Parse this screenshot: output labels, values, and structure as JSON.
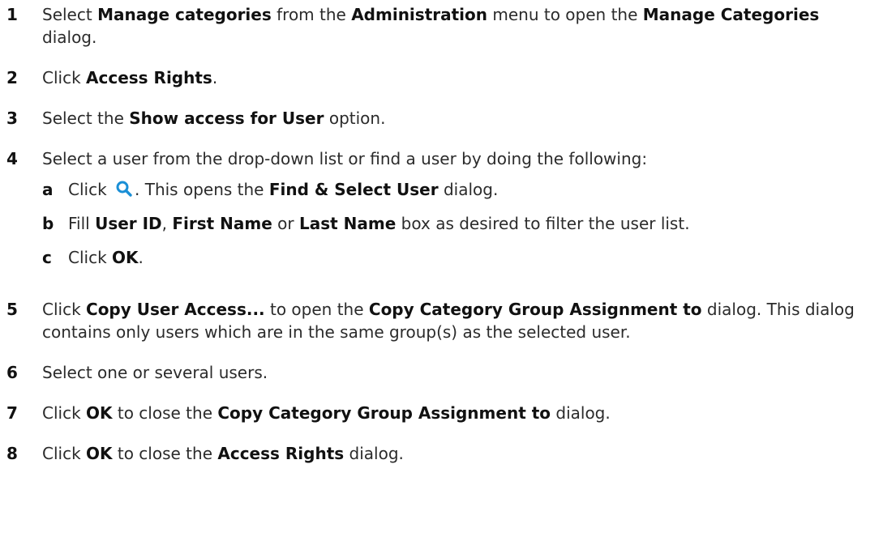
{
  "steps": [
    {
      "num": "1",
      "parts": [
        {
          "t": "Select "
        },
        {
          "t": "Manage categories",
          "b": true
        },
        {
          "t": " from the "
        },
        {
          "t": "Administration",
          "b": true
        },
        {
          "t": " menu to open the "
        },
        {
          "t": "Manage Categories",
          "b": true
        },
        {
          "t": " dialog."
        }
      ]
    },
    {
      "num": "2",
      "parts": [
        {
          "t": "Click "
        },
        {
          "t": "Access Rights",
          "b": true
        },
        {
          "t": "."
        }
      ]
    },
    {
      "num": "3",
      "parts": [
        {
          "t": "Select the "
        },
        {
          "t": "Show access for User",
          "b": true
        },
        {
          "t": " option."
        }
      ]
    },
    {
      "num": "4",
      "parts": [
        {
          "t": "Select a user from the drop-down list or find a user by doing the following:"
        }
      ],
      "sub": [
        {
          "num": "a",
          "parts": [
            {
              "t": "Click "
            },
            {
              "icon": "search-icon"
            },
            {
              "t": ". This opens the "
            },
            {
              "t": "Find & Select User",
              "b": true
            },
            {
              "t": " dialog."
            }
          ]
        },
        {
          "num": "b",
          "parts": [
            {
              "t": "Fill "
            },
            {
              "t": "User ID",
              "b": true
            },
            {
              "t": ", "
            },
            {
              "t": "First Name",
              "b": true
            },
            {
              "t": " or "
            },
            {
              "t": "Last Name",
              "b": true
            },
            {
              "t": " box as desired to filter the user list."
            }
          ]
        },
        {
          "num": "c",
          "parts": [
            {
              "t": "Click "
            },
            {
              "t": "OK",
              "b": true
            },
            {
              "t": "."
            }
          ]
        }
      ]
    },
    {
      "num": "5",
      "parts": [
        {
          "t": "Click "
        },
        {
          "t": "Copy User Access...",
          "b": true
        },
        {
          "t": " to open the "
        },
        {
          "t": "Copy Category Group Assignment to",
          "b": true
        },
        {
          "t": " dialog. This dialog contains only users which are in the same group(s) as the selected user."
        }
      ]
    },
    {
      "num": "6",
      "parts": [
        {
          "t": "Select one or several users."
        }
      ]
    },
    {
      "num": "7",
      "parts": [
        {
          "t": "Click "
        },
        {
          "t": "OK",
          "b": true
        },
        {
          "t": " to close the "
        },
        {
          "t": "Copy Category Group Assignment to",
          "b": true
        },
        {
          "t": " dialog."
        }
      ]
    },
    {
      "num": "8",
      "parts": [
        {
          "t": "Click "
        },
        {
          "t": "OK",
          "b": true
        },
        {
          "t": " to close the "
        },
        {
          "t": "Access Rights",
          "b": true
        },
        {
          "t": " dialog."
        }
      ]
    }
  ],
  "colors": {
    "text": "#2b2b2b",
    "icon": "#1a8fd6"
  }
}
